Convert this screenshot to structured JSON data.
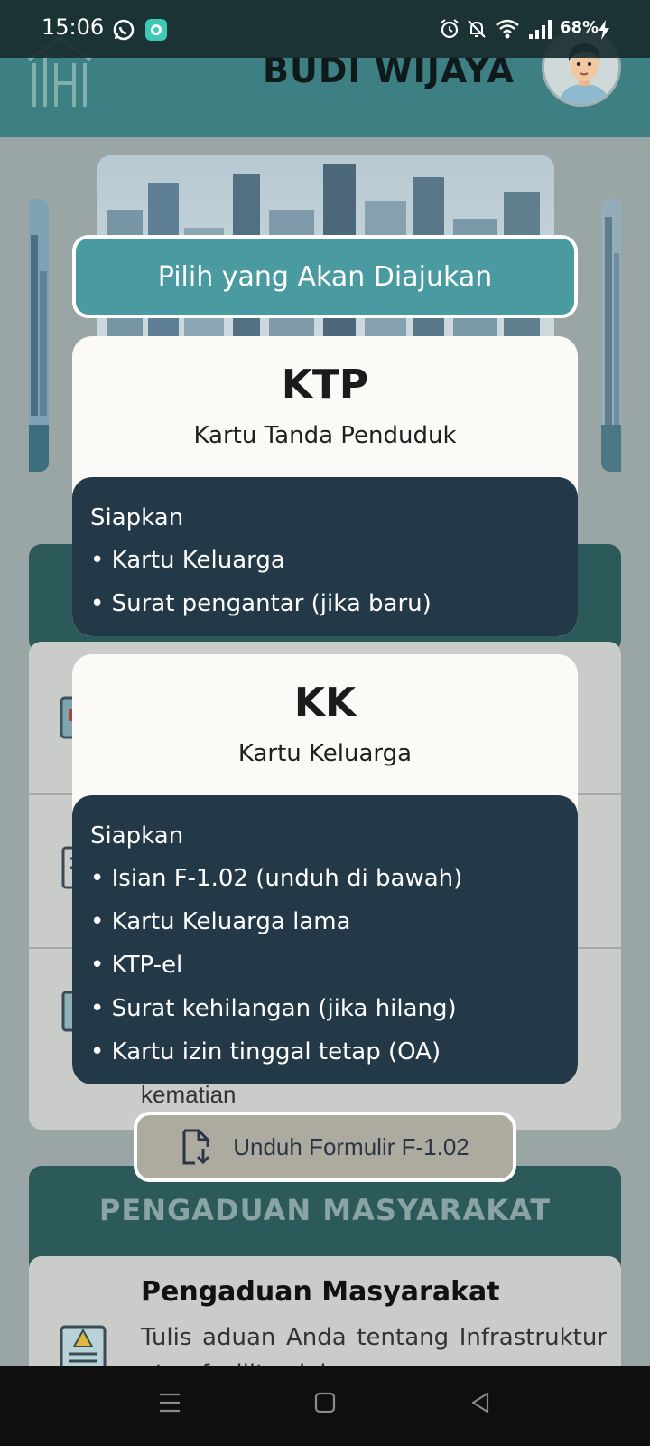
{
  "status_bar": {
    "time": "15:06",
    "battery": "68%",
    "icons": [
      "whatsapp-icon",
      "app-notification-icon",
      "alarm-icon",
      "bell-off-icon",
      "wifi-icon",
      "signal-icon",
      "battery-charging-icon"
    ]
  },
  "header": {
    "user_name": "BUDI WIJAYA"
  },
  "modal": {
    "title": "Pilih yang Akan Diajukan",
    "documents": [
      {
        "code": "KTP",
        "name": "Kartu Tanda Penduduk",
        "requirements_heading": "Siapkan",
        "requirements": [
          "• Kartu Keluarga",
          "• Surat pengantar (jika baru)"
        ]
      },
      {
        "code": "KK",
        "name": "Kartu Keluarga",
        "requirements_heading": "Siapkan",
        "requirements": [
          "• Isian F-1.02 (unduh di bawah)",
          "• Kartu Keluarga lama",
          "• KTP-el",
          "• Surat kehilangan (jika hilang)",
          "• Kartu izin tinggal tetap (OA)"
        ]
      }
    ],
    "download_label": "Unduh Formulir F-1.02"
  },
  "background": {
    "partial_text": "kematian",
    "complaint_section_title": "PENGADUAN MASYARAKAT",
    "complaint_card_title": "Pengaduan Masyarakat",
    "complaint_card_desc": "Tulis aduan Anda tentang Infrastruktur atau fasilitas lain"
  },
  "colors": {
    "header": "#3d7f82",
    "modal_title_bg": "#4a9aa2",
    "requirements_bg": "#243947",
    "card_bg": "#fbfaf7",
    "download_bg": "#adab9f"
  }
}
